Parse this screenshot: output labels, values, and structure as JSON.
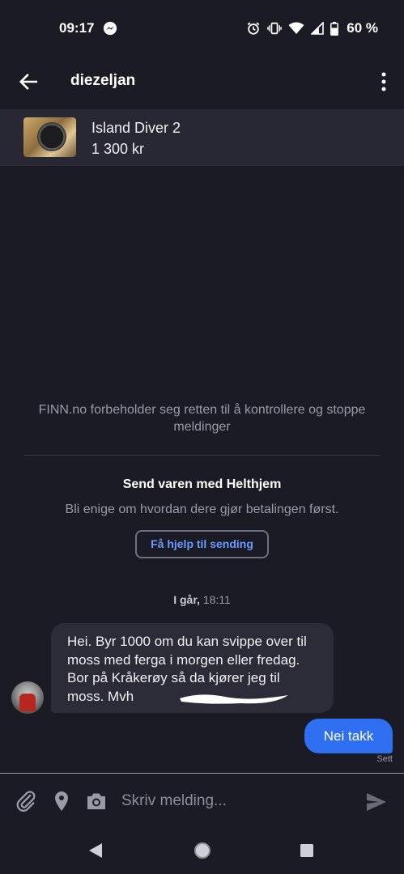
{
  "status_bar": {
    "time": "09:17",
    "battery": "60 %"
  },
  "app_bar": {
    "title": "diezeljan"
  },
  "listing": {
    "title": "Island Diver 2",
    "price": "1 300 kr"
  },
  "notice": {
    "text": "FINN.no forbeholder seg retten til å kontrollere og stoppe meldinger"
  },
  "shipping": {
    "title": "Send varen med Helthjem",
    "subtitle": "Bli enige om hvordan dere gjør betalingen først.",
    "button_label": "Få hjelp til sending"
  },
  "date_separator": {
    "day": "I går,",
    "time": "18:11"
  },
  "messages": [
    {
      "direction": "incoming",
      "text": "Hei. Byr 1000 om du kan svippe over til moss med ferga i morgen eller fredag. Bor på Kråkerøy så da kjører jeg til moss. Mvh"
    },
    {
      "direction": "outgoing",
      "text": "Nei takk",
      "status": "Sett"
    }
  ],
  "composer": {
    "placeholder": "Skriv melding..."
  },
  "colors": {
    "background": "#1b1b25",
    "card": "#282834",
    "incoming_bubble": "#2c2c38",
    "outgoing_bubble": "#2f6ff1",
    "link": "#6c9bff"
  },
  "icons": [
    "messenger-icon",
    "alarm-icon",
    "vibrate-icon",
    "wifi-icon",
    "signal-icon",
    "battery-icon",
    "back-arrow-icon",
    "more-vert-icon",
    "attach-icon",
    "location-icon",
    "camera-icon",
    "send-icon",
    "nav-back-icon",
    "nav-home-icon",
    "nav-recents-icon"
  ]
}
